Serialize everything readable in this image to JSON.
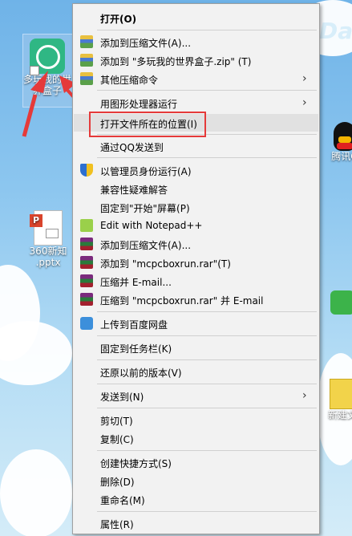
{
  "desktop": {
    "icons": [
      {
        "label": "多玩我的世\n界盒子",
        "line1": "多玩我的世",
        "line2": "界盒子"
      },
      {
        "label": "360新知\n.pptx",
        "line1": "360新知",
        "line2": ".pptx"
      },
      {
        "label": "腾讯Q",
        "line1": "腾讯Q"
      },
      {
        "label": "新建文",
        "line1": "新建文"
      }
    ],
    "logo_text": "Da"
  },
  "context_menu": {
    "items": [
      {
        "label": "打开(O)",
        "bold": true
      },
      {
        "label": "添加到压缩文件(A)...",
        "icon": "winrar-icon"
      },
      {
        "label": "添加到 \"多玩我的世界盒子.zip\" (T)",
        "icon": "winrar-icon"
      },
      {
        "label": "其他压缩命令",
        "icon": "winrar-icon",
        "submenu": true
      },
      {
        "label": "用图形处理器运行",
        "submenu": true
      },
      {
        "label": "打开文件所在的位置(I)",
        "highlighted": true
      },
      {
        "label": "通过QQ发送到"
      },
      {
        "label": "以管理员身份运行(A)",
        "icon": "shield-icon"
      },
      {
        "label": "兼容性疑难解答"
      },
      {
        "label": "固定到\"开始\"屏幕(P)"
      },
      {
        "label": "Edit with Notepad++",
        "icon": "notepad-icon"
      },
      {
        "label": "添加到压缩文件(A)...",
        "icon": "rar-icon"
      },
      {
        "label": "添加到 \"mcpcboxrun.rar\"(T)",
        "icon": "rar-icon"
      },
      {
        "label": "压缩并 E-mail...",
        "icon": "rar-icon"
      },
      {
        "label": "压缩到 \"mcpcboxrun.rar\" 并 E-mail",
        "icon": "rar-icon"
      },
      {
        "label": "上传到百度网盘",
        "icon": "baidu-cloud-icon"
      },
      {
        "label": "固定到任务栏(K)"
      },
      {
        "label": "还原以前的版本(V)"
      },
      {
        "label": "发送到(N)",
        "submenu": true
      },
      {
        "label": "剪切(T)"
      },
      {
        "label": "复制(C)"
      },
      {
        "label": "创建快捷方式(S)"
      },
      {
        "label": "删除(D)"
      },
      {
        "label": "重命名(M)"
      },
      {
        "label": "属性(R)"
      }
    ]
  },
  "colors": {
    "menu_bg": "#f2f2f2",
    "hover_bg": "#e1e1e1",
    "annotation_red": "#e53a3a"
  }
}
